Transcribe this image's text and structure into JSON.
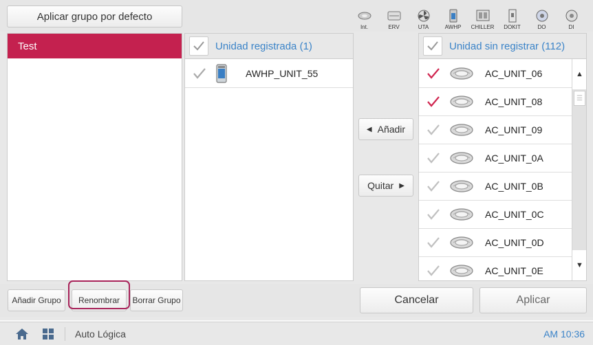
{
  "header": {
    "apply_default_label": "Aplicar grupo por defecto",
    "filters": [
      {
        "label": "Int.",
        "icon": "indoor-unit-icon"
      },
      {
        "label": "ERV",
        "icon": "erv-icon"
      },
      {
        "label": "UTA",
        "icon": "fan-icon"
      },
      {
        "label": "AWHP",
        "icon": "awhp-icon"
      },
      {
        "label": "CHILLER",
        "icon": "chiller-icon"
      },
      {
        "label": "DOKIT",
        "icon": "dokit-icon"
      },
      {
        "label": "DO",
        "icon": "do-icon"
      },
      {
        "label": "DI",
        "icon": "di-icon"
      }
    ]
  },
  "groups": {
    "selected": "Test"
  },
  "registered": {
    "header": "Unidad registrada (1)",
    "items": [
      {
        "name": "AWHP_UNIT_55",
        "checked": true
      }
    ]
  },
  "transfer": {
    "add_label": "Añadir",
    "remove_label": "Quitar"
  },
  "unregistered": {
    "header": "Unidad sin registrar (112)",
    "items": [
      {
        "name": "AC_UNIT_06",
        "checked": true
      },
      {
        "name": "AC_UNIT_08",
        "checked": true
      },
      {
        "name": "AC_UNIT_09",
        "checked": false
      },
      {
        "name": "AC_UNIT_0A",
        "checked": false
      },
      {
        "name": "AC_UNIT_0B",
        "checked": false
      },
      {
        "name": "AC_UNIT_0C",
        "checked": false
      },
      {
        "name": "AC_UNIT_0D",
        "checked": false
      },
      {
        "name": "AC_UNIT_0E",
        "checked": false
      }
    ]
  },
  "footer": {
    "add_group": "Añadir Grupo",
    "rename": "Renombrar",
    "delete_group": "Borrar Grupo",
    "cancel": "Cancelar",
    "apply": "Aplicar"
  },
  "taskbar": {
    "title": "Auto Lógica",
    "time": "AM 10:36"
  },
  "colors": {
    "accent": "#c4214f",
    "header_text": "#3a83c8",
    "check_active": "#d0254f",
    "check_inactive": "#aaaaaa"
  }
}
